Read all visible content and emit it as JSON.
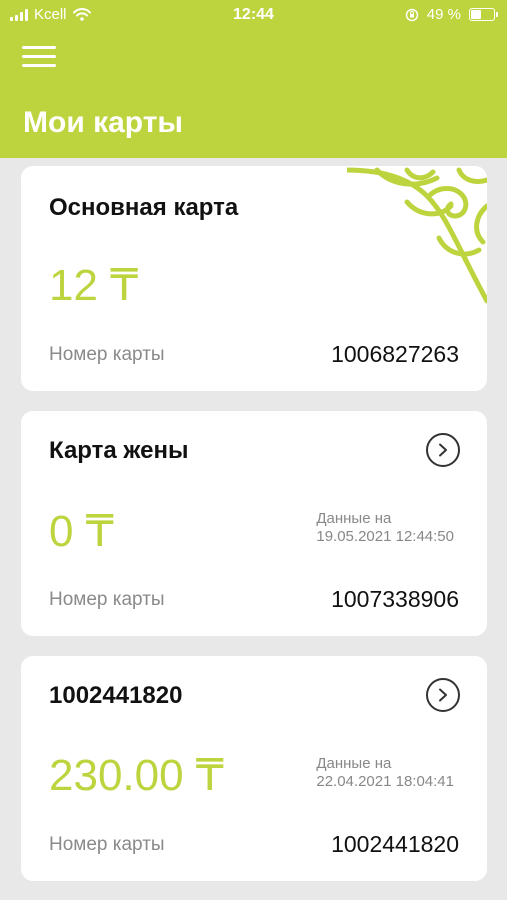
{
  "status_bar": {
    "carrier": "Kcell",
    "time": "12:44",
    "battery": "49 %",
    "battery_level": 0.49
  },
  "header": {
    "title": "Мои карты",
    "menu_icon": "hamburger-menu-icon"
  },
  "colors": {
    "brand": "#bed43f",
    "background": "#e8e8e8"
  },
  "cards": [
    {
      "title": "Основная карта",
      "balance": "12 ₸",
      "number_label": "Номер карты",
      "number": "1006827263"
    },
    {
      "title": "Карта жены",
      "balance": "0 ₸",
      "data_label": "Данные на",
      "data_time": "19.05.2021 12:44:50",
      "number_label": "Номер карты",
      "number": "1007338906"
    },
    {
      "title": "1002441820",
      "balance": "230.00 ₸",
      "data_label": "Данные на",
      "data_time": "22.04.2021 18:04:41",
      "number_label": "Номер карты",
      "number": "1002441820"
    }
  ]
}
